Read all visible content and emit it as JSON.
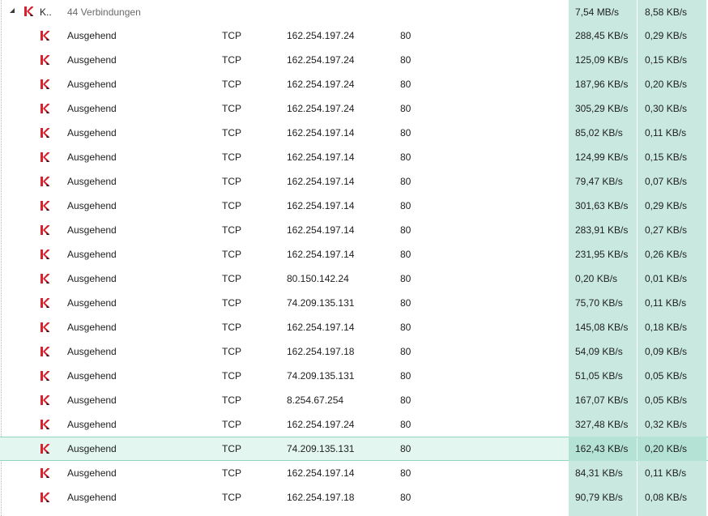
{
  "group": {
    "name_truncated": "K..",
    "count_label": "44 Verbindungen",
    "download_total": "7,54 MB/s",
    "upload_total": "8,58 KB/s",
    "icon": "kaspersky-k-icon",
    "expander_icon": "triangle-expanded-icon"
  },
  "colors": {
    "rate_column_bg": "#c9e9e0",
    "selected_row_bg": "#e3f7f0",
    "icon_red": "#d8212f"
  },
  "rows": [
    {
      "direction": "Ausgehend",
      "protocol": "TCP",
      "ip": "162.254.197.24",
      "port": "80",
      "download": "288,45 KB/s",
      "upload": "0,29 KB/s"
    },
    {
      "direction": "Ausgehend",
      "protocol": "TCP",
      "ip": "162.254.197.24",
      "port": "80",
      "download": "125,09 KB/s",
      "upload": "0,15 KB/s"
    },
    {
      "direction": "Ausgehend",
      "protocol": "TCP",
      "ip": "162.254.197.24",
      "port": "80",
      "download": "187,96 KB/s",
      "upload": "0,20 KB/s"
    },
    {
      "direction": "Ausgehend",
      "protocol": "TCP",
      "ip": "162.254.197.24",
      "port": "80",
      "download": "305,29 KB/s",
      "upload": "0,30 KB/s"
    },
    {
      "direction": "Ausgehend",
      "protocol": "TCP",
      "ip": "162.254.197.14",
      "port": "80",
      "download": "85,02 KB/s",
      "upload": "0,11 KB/s"
    },
    {
      "direction": "Ausgehend",
      "protocol": "TCP",
      "ip": "162.254.197.14",
      "port": "80",
      "download": "124,99 KB/s",
      "upload": "0,15 KB/s"
    },
    {
      "direction": "Ausgehend",
      "protocol": "TCP",
      "ip": "162.254.197.14",
      "port": "80",
      "download": "79,47 KB/s",
      "upload": "0,07 KB/s"
    },
    {
      "direction": "Ausgehend",
      "protocol": "TCP",
      "ip": "162.254.197.14",
      "port": "80",
      "download": "301,63 KB/s",
      "upload": "0,29 KB/s"
    },
    {
      "direction": "Ausgehend",
      "protocol": "TCP",
      "ip": "162.254.197.14",
      "port": "80",
      "download": "283,91 KB/s",
      "upload": "0,27 KB/s"
    },
    {
      "direction": "Ausgehend",
      "protocol": "TCP",
      "ip": "162.254.197.14",
      "port": "80",
      "download": "231,95 KB/s",
      "upload": "0,26 KB/s"
    },
    {
      "direction": "Ausgehend",
      "protocol": "TCP",
      "ip": "80.150.142.24",
      "port": "80",
      "download": "0,20 KB/s",
      "upload": "0,01 KB/s"
    },
    {
      "direction": "Ausgehend",
      "protocol": "TCP",
      "ip": "74.209.135.131",
      "port": "80",
      "download": "75,70 KB/s",
      "upload": "0,11 KB/s"
    },
    {
      "direction": "Ausgehend",
      "protocol": "TCP",
      "ip": "162.254.197.14",
      "port": "80",
      "download": "145,08 KB/s",
      "upload": "0,18 KB/s"
    },
    {
      "direction": "Ausgehend",
      "protocol": "TCP",
      "ip": "162.254.197.18",
      "port": "80",
      "download": "54,09 KB/s",
      "upload": "0,09 KB/s"
    },
    {
      "direction": "Ausgehend",
      "protocol": "TCP",
      "ip": "74.209.135.131",
      "port": "80",
      "download": "51,05 KB/s",
      "upload": "0,05 KB/s"
    },
    {
      "direction": "Ausgehend",
      "protocol": "TCP",
      "ip": "8.254.67.254",
      "port": "80",
      "download": "167,07 KB/s",
      "upload": "0,05 KB/s"
    },
    {
      "direction": "Ausgehend",
      "protocol": "TCP",
      "ip": "162.254.197.24",
      "port": "80",
      "download": "327,48 KB/s",
      "upload": "0,32 KB/s"
    },
    {
      "direction": "Ausgehend",
      "protocol": "TCP",
      "ip": "74.209.135.131",
      "port": "80",
      "download": "162,43 KB/s",
      "upload": "0,20 KB/s",
      "selected": true
    },
    {
      "direction": "Ausgehend",
      "protocol": "TCP",
      "ip": "162.254.197.14",
      "port": "80",
      "download": "84,31 KB/s",
      "upload": "0,11 KB/s"
    },
    {
      "direction": "Ausgehend",
      "protocol": "TCP",
      "ip": "162.254.197.18",
      "port": "80",
      "download": "90,79 KB/s",
      "upload": "0,08 KB/s"
    }
  ]
}
